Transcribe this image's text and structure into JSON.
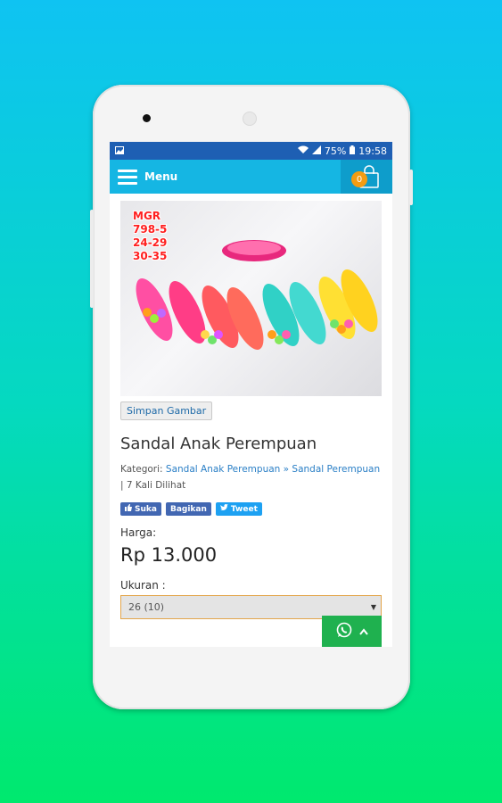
{
  "status_bar": {
    "battery": "75%",
    "time": "19:58"
  },
  "app_bar": {
    "menu_label": "Menu",
    "cart_count": "0"
  },
  "product": {
    "image_label_lines": [
      "MGR",
      "798-5",
      "24-29",
      "30-35"
    ],
    "save_image_label": "Simpan Gambar",
    "title": "Sandal Anak Perempuan",
    "category_prefix": "Kategori:",
    "category_link": "Sandal Anak Perempuan » Sandal Perempuan",
    "views": "| 7 Kali Dilihat",
    "price_label": "Harga:",
    "price": "Rp 13.000",
    "size_label": "Ukuran :",
    "size_selected": "26 (10)"
  },
  "social": {
    "like": "Suka",
    "share": "Bagikan",
    "tweet": "Tweet"
  },
  "colors": {
    "app_bar": "#15b6e3",
    "status_bar": "#1e5fb3",
    "cart_badge": "#f39c12",
    "whatsapp": "#1fb14f"
  }
}
